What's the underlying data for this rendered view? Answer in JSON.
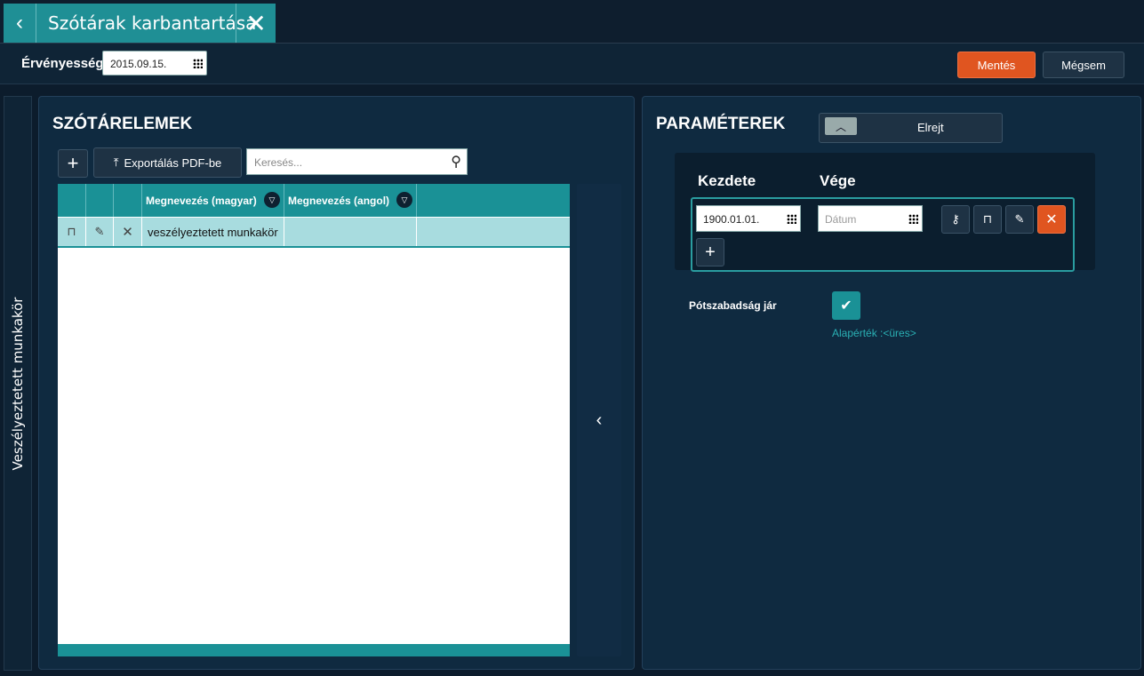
{
  "tab": {
    "title": "Szótárak karbantartása",
    "back": "‹",
    "close": "✕"
  },
  "toolbar": {
    "validity_label": "Érvényesség",
    "validity_date": "2015.09.15.",
    "save": "Mentés",
    "cancel": "Mégsem"
  },
  "sidebar": {
    "label": "Veszélyeztetett munkakör"
  },
  "left": {
    "title": "SZÓTÁRELEMEK",
    "add": "+",
    "export": "Exportálás PDF-be",
    "search_placeholder": "Keresés...",
    "columns": [
      "Megnevezés (magyar)",
      "Megnevezés (angol)"
    ],
    "rows": [
      {
        "hu": "veszélyeztetett munkakör",
        "en": ""
      }
    ],
    "collapse": "‹"
  },
  "right": {
    "title": "PARAMÉTEREK",
    "hide": "Elrejt",
    "start_label": "Kezdete",
    "end_label": "Vége",
    "start_value": "1900.01.01.",
    "end_placeholder": "Dátum",
    "add": "+",
    "extra_label": "Pótszabadság jár",
    "default_text": "Alapérték :<üres>"
  },
  "colors": {
    "accent": "#1a9196",
    "danger": "#e05520",
    "bg": "#0c1c2c"
  }
}
